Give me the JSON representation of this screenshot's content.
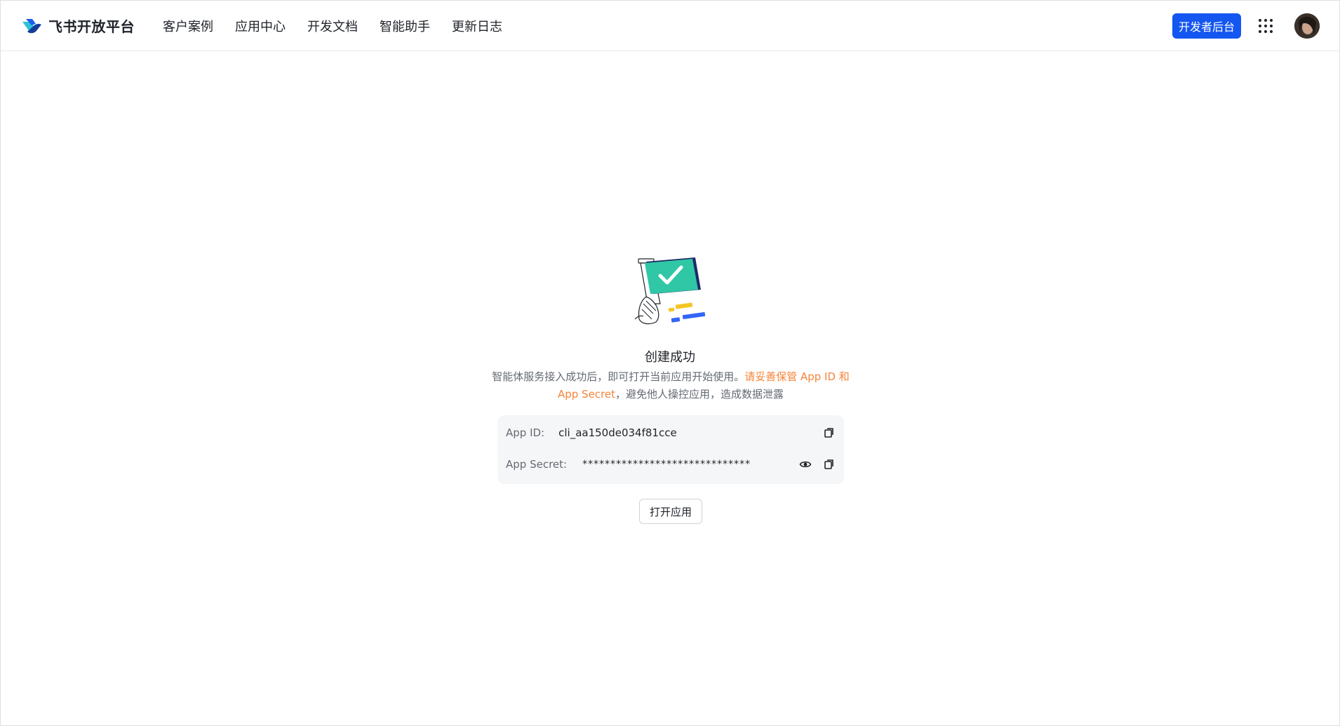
{
  "header": {
    "brand_name": "飞书开放平台",
    "nav": [
      {
        "label": "客户案例"
      },
      {
        "label": "应用中心"
      },
      {
        "label": "开发文档"
      },
      {
        "label": "智能助手"
      },
      {
        "label": "更新日志"
      }
    ],
    "dev_console_label": "开发者后台",
    "apps_icon": "grid-icon",
    "avatar": "user-avatar"
  },
  "main": {
    "illustration": "success-check-illustration",
    "title": "创建成功",
    "desc_prefix": "智能体服务接入成功后，即可打开当前应用开始使用。",
    "desc_highlight": "请妥善保管 App ID 和 App Secret",
    "desc_suffix": "，避免他人操控应用，造成数据泄露",
    "credentials": {
      "app_id_label": "App ID:",
      "app_id_value": "cli_aa150de034f81cce",
      "app_secret_label": "App Secret:",
      "app_secret_value": "******************************"
    },
    "open_app_label": "打开应用"
  },
  "colors": {
    "primary": "#1456f0",
    "highlight": "#f5843a",
    "success_green": "#2fc7a6",
    "muted_text": "#646a73"
  }
}
